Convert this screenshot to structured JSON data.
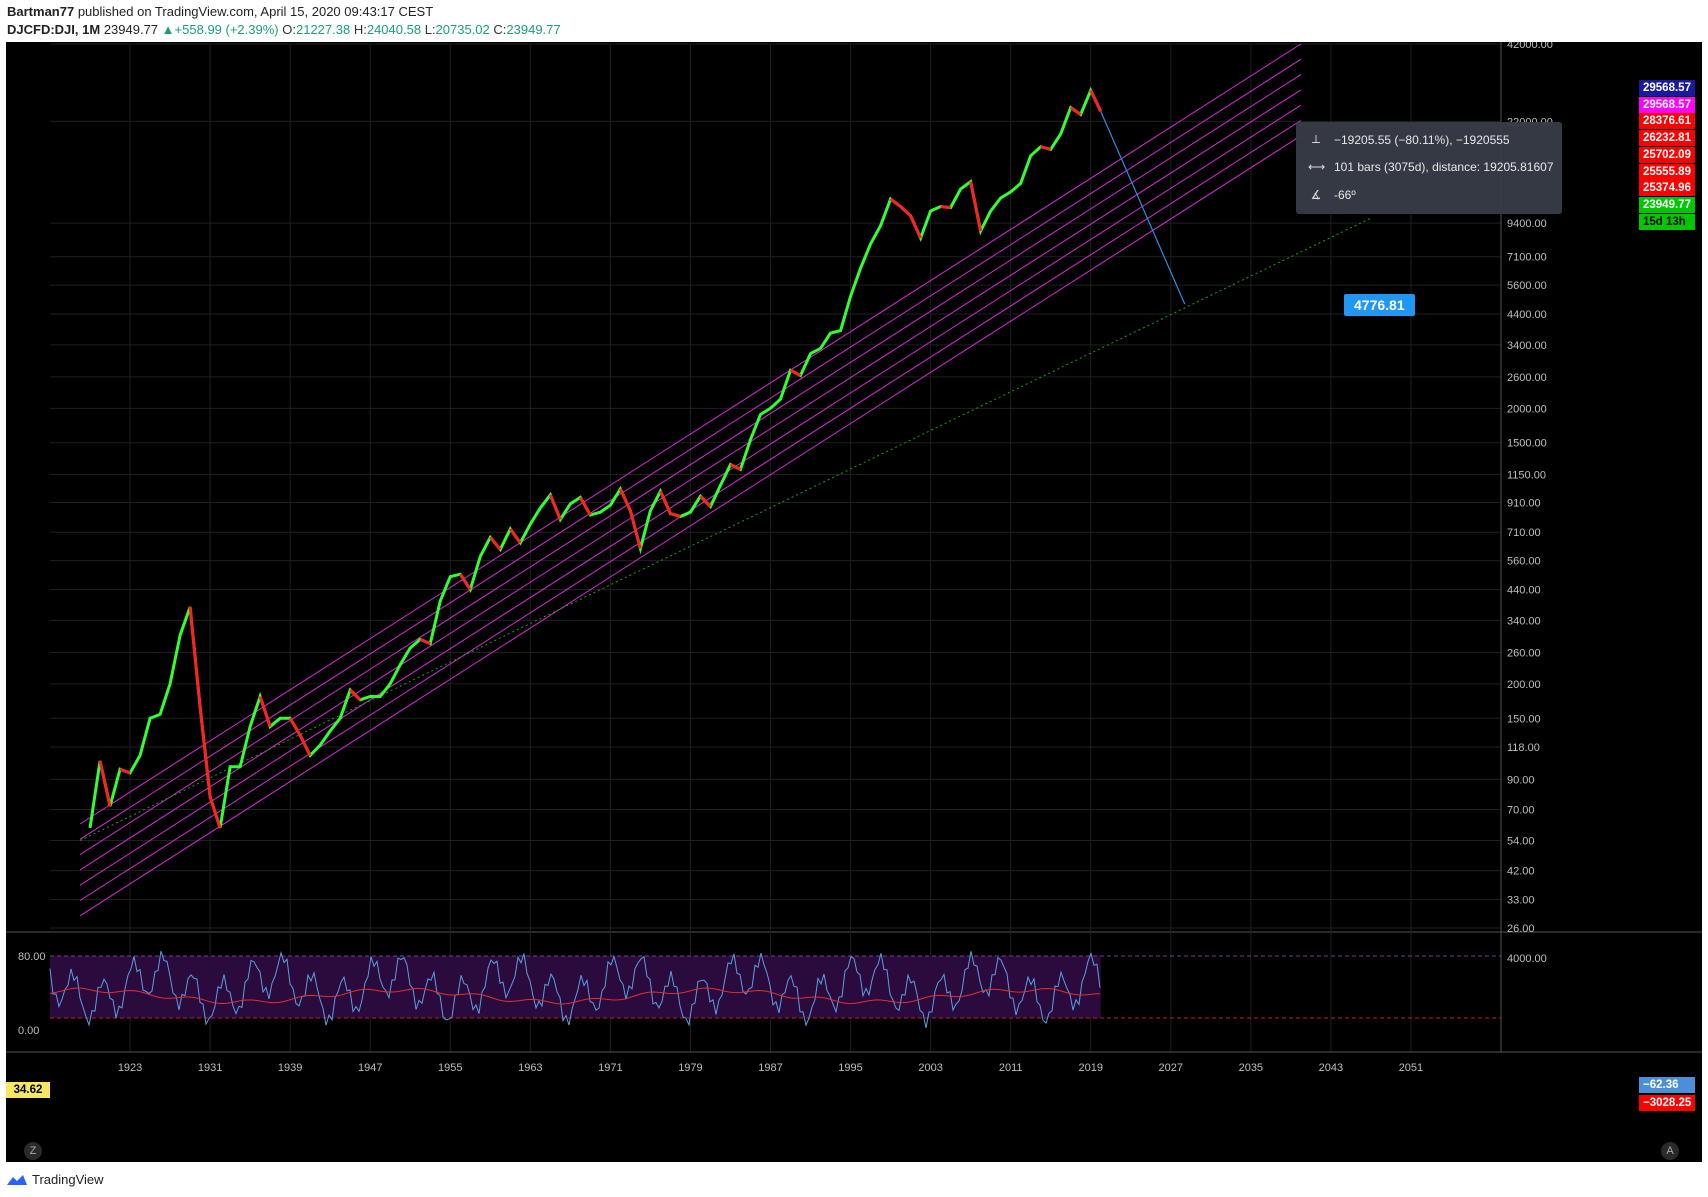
{
  "header": {
    "publisher": "Bartman77",
    "published_text": "published on TradingView.com, April 15, 2020 09:43:17 CEST",
    "symbol": "DJCFD:DJI, 1M",
    "last": "23949.77",
    "change": "+558.99 (+2.39%)",
    "o_label": "O:",
    "o_value": "21227.38",
    "h_label": "H:",
    "h_value": "24040.58",
    "l_label": "L:",
    "l_value": "20735.02",
    "c_label": "C:",
    "c_value": "23949.77"
  },
  "footer": {
    "brand": "TradingView"
  },
  "measure_tooltip": {
    "price_range": "−19205.55 (−80.11%), −1920555",
    "bars_range": "101 bars (3075d), distance: 19205.81607",
    "angle": "-66º"
  },
  "target_badge": "4776.81",
  "price_labels": [
    {
      "text": "29568.57",
      "bg": "#1a1a9e",
      "fg": "#ffffff"
    },
    {
      "text": "29568.57",
      "bg": "#ff00ff",
      "fg": "#ffffff"
    },
    {
      "text": "28376.61",
      "bg": "#ff0000",
      "fg": "#ffffff"
    },
    {
      "text": "26232.81",
      "bg": "#ff0000",
      "fg": "#ffffff"
    },
    {
      "text": "25702.09",
      "bg": "#ff0000",
      "fg": "#ffffff"
    },
    {
      "text": "25555.89",
      "bg": "#ff0000",
      "fg": "#ffffff"
    },
    {
      "text": "25374.96",
      "bg": "#ff0000",
      "fg": "#ffffff"
    },
    {
      "text": "23949.77",
      "bg": "#00c800",
      "fg": "#ffffff"
    },
    {
      "text": "15d 13h",
      "bg": "#00c800",
      "fg": "#000000"
    }
  ],
  "indicator_labels": {
    "left": "34.62",
    "right_1": "−62.36",
    "right_2": "−3028.25"
  },
  "corner_buttons": {
    "left": "Z",
    "right": "A"
  },
  "chart_data": {
    "type": "line",
    "title": "",
    "xlabel": "",
    "ylabel": "",
    "y_scale": "log",
    "ylim": [
      26,
      42000
    ],
    "xlim": [
      1915,
      2060
    ],
    "x_ticks": [
      "1923",
      "1931",
      "1939",
      "1947",
      "1955",
      "1963",
      "1971",
      "1979",
      "1987",
      "1995",
      "2003",
      "2011",
      "2019",
      "2027",
      "2035",
      "2043",
      "2051"
    ],
    "y_ticks": [
      "42000.00",
      "22000.00",
      "9400.00",
      "7100.00",
      "5600.00",
      "4400.00",
      "3400.00",
      "2600.00",
      "2000.00",
      "1500.00",
      "1150.00",
      "910.00",
      "710.00",
      "560.00",
      "440.00",
      "340.00",
      "260.00",
      "200.00",
      "150.00",
      "118.00",
      "90.00",
      "70.00",
      "54.00",
      "42.00",
      "33.00",
      "26.00"
    ],
    "series": [
      {
        "name": "",
        "x": [
          1919,
          1920,
          1921,
          1922,
          1923,
          1924,
          1925,
          1926,
          1927,
          1928,
          1929,
          1930,
          1931,
          1932,
          1933,
          1934,
          1935,
          1936,
          1937,
          1938,
          1939,
          1940,
          1941,
          1942,
          1943,
          1944,
          1945,
          1946,
          1947,
          1948,
          1949,
          1950,
          1951,
          1952,
          1953,
          1954,
          1955,
          1956,
          1957,
          1958,
          1959,
          1960,
          1961,
          1962,
          1963,
          1964,
          1965,
          1966,
          1967,
          1968,
          1969,
          1970,
          1971,
          1972,
          1973,
          1974,
          1975,
          1976,
          1977,
          1978,
          1979,
          1980,
          1981,
          1982,
          1983,
          1984,
          1985,
          1986,
          1987,
          1988,
          1989,
          1990,
          1991,
          1992,
          1993,
          1994,
          1995,
          1996,
          1997,
          1998,
          1999,
          2000,
          2001,
          2002,
          2003,
          2004,
          2005,
          2006,
          2007,
          2008,
          2009,
          2010,
          2011,
          2012,
          2013,
          2014,
          2015,
          2016,
          2017,
          2018,
          2019,
          2020
        ],
        "values": [
          60,
          105,
          72,
          98,
          95,
          110,
          150,
          155,
          200,
          300,
          380,
          165,
          78,
          60,
          100,
          100,
          140,
          180,
          140,
          150,
          150,
          130,
          110,
          120,
          135,
          150,
          190,
          175,
          180,
          180,
          200,
          235,
          270,
          290,
          280,
          400,
          490,
          500,
          440,
          580,
          680,
          615,
          730,
          650,
          760,
          870,
          970,
          790,
          900,
          950,
          820,
          840,
          890,
          1020,
          850,
          620,
          850,
          1000,
          830,
          810,
          840,
          960,
          880,
          1050,
          1250,
          1200,
          1540,
          1900,
          2000,
          2160,
          2750,
          2630,
          3160,
          3300,
          3750,
          3830,
          5100,
          6450,
          7900,
          9200,
          11500,
          10800,
          10000,
          8300,
          10400,
          10800,
          10700,
          12500,
          13300,
          8800,
          10400,
          11600,
          12200,
          13100,
          16500,
          17800,
          17400,
          19800,
          24700,
          23300,
          28500,
          23949.77
        ]
      }
    ],
    "channel_upper_start": [
      1918,
      62
    ],
    "channel_upper_end": [
      2040,
      42000
    ],
    "support_line_start": [
      1918,
      54
    ],
    "support_line_end": [
      2047,
      9800
    ],
    "oscillator": {
      "labels": [
        "80.00",
        "0.00",
        "4000.00"
      ],
      "ylim": [
        0,
        100
      ]
    }
  }
}
